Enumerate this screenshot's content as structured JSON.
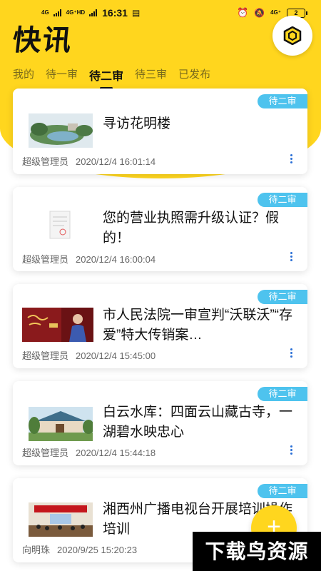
{
  "status": {
    "network1": "4G",
    "network2": "4G⁺HD",
    "time": "16:31",
    "network3": "4G⁺",
    "battery": "2"
  },
  "header": {
    "app_title": "快讯",
    "tabs": [
      {
        "label": "我的"
      },
      {
        "label": "待一审"
      },
      {
        "label": "待二审"
      },
      {
        "label": "待三审"
      },
      {
        "label": "已发布"
      }
    ]
  },
  "articles": [
    {
      "badge": "待二审",
      "title": "寻访花明楼",
      "author": "超级管理员",
      "date": "2020/12/4 16:01:14"
    },
    {
      "badge": "待二审",
      "title": "您的营业执照需升级认证？假的！",
      "author": "超级管理员",
      "date": "2020/12/4 16:00:04"
    },
    {
      "badge": "待二审",
      "title": "市人民法院一审宣判“沃联沃”“存爱”特大传销案…",
      "author": "超级管理员",
      "date": "2020/12/4 15:45:00"
    },
    {
      "badge": "待二审",
      "title": "白云水库：四面云山藏古寺，一湖碧水映忠心",
      "author": "超级管理员",
      "date": "2020/12/4 15:44:18"
    },
    {
      "badge": "待二审",
      "title": "湘西州广播电视台开展培训操作培训",
      "author": "向明珠",
      "date": "2020/9/25 15:20:23"
    }
  ],
  "fab_label": "+",
  "watermark": "下载鸟资源",
  "colors": {
    "accent": "#ffd61e",
    "badge": "#4ec3ee",
    "more": "#2a6fd6"
  }
}
